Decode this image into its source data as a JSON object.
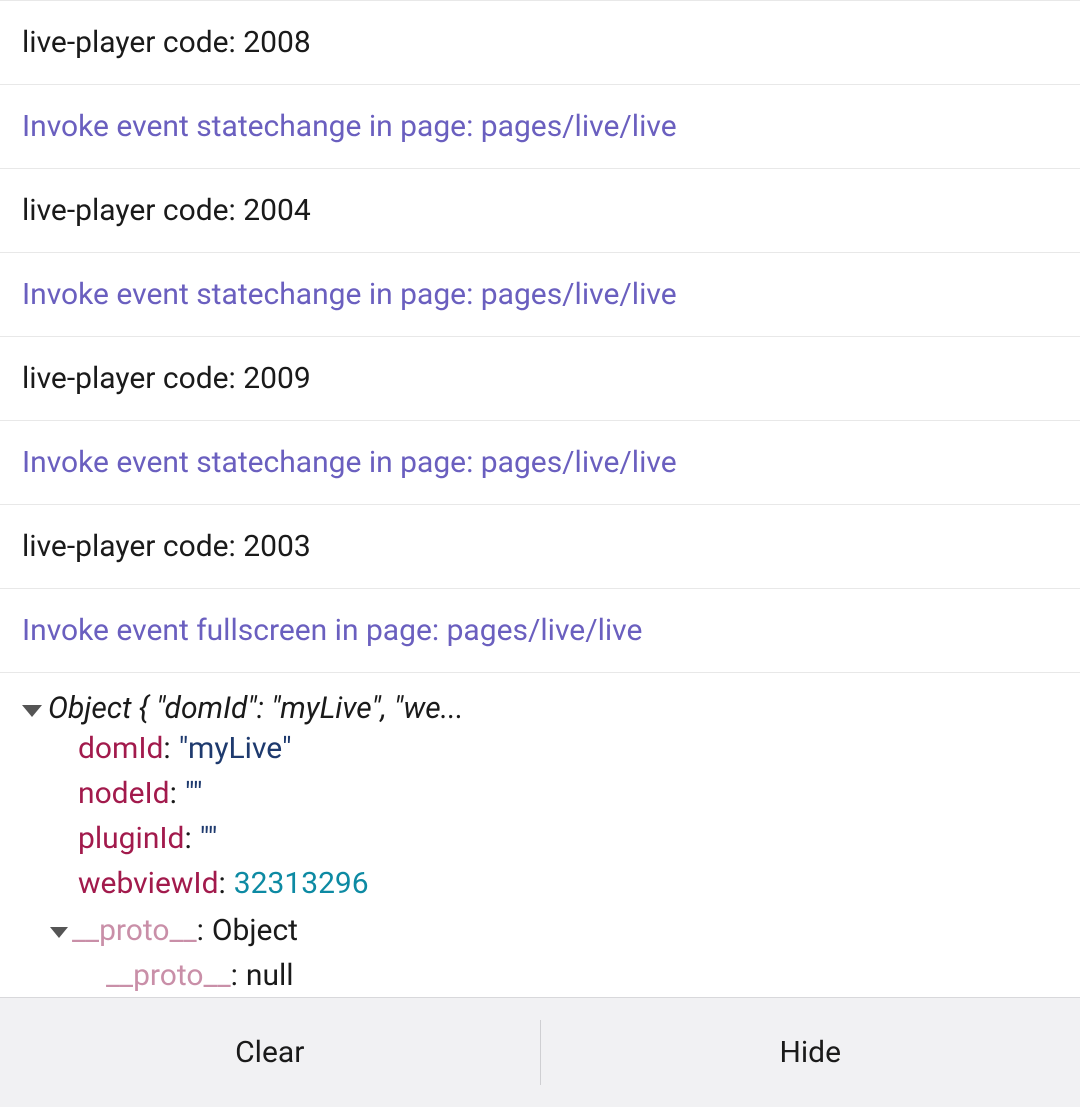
{
  "logs": [
    {
      "type": "black",
      "text": "live-player code: 2008"
    },
    {
      "type": "purple",
      "text": "Invoke event statechange in page: pages/live/live"
    },
    {
      "type": "black",
      "text": "live-player code: 2004"
    },
    {
      "type": "purple",
      "text": "Invoke event statechange in page: pages/live/live"
    },
    {
      "type": "black",
      "text": "live-player code: 2009"
    },
    {
      "type": "purple",
      "text": "Invoke event statechange in page: pages/live/live"
    },
    {
      "type": "black",
      "text": "live-player code: 2003"
    },
    {
      "type": "purple",
      "text": "Invoke event fullscreen in page: pages/live/live"
    }
  ],
  "object": {
    "summary": "Object { \"domId\": \"myLive\", \"we...",
    "props": {
      "domId": {
        "key": "domId",
        "value": "\"myLive\"",
        "kind": "string"
      },
      "nodeId": {
        "key": "nodeId",
        "value": "\"\"",
        "kind": "string"
      },
      "pluginId": {
        "key": "pluginId",
        "value": "\"\"",
        "kind": "string"
      },
      "webviewId": {
        "key": "webviewId",
        "value": "32313296",
        "kind": "number"
      }
    },
    "proto": {
      "key": "__proto__",
      "value": "Object",
      "nested": {
        "key": "__proto__",
        "value": "null"
      }
    }
  },
  "buttons": {
    "clear": "Clear",
    "hide": "Hide"
  }
}
